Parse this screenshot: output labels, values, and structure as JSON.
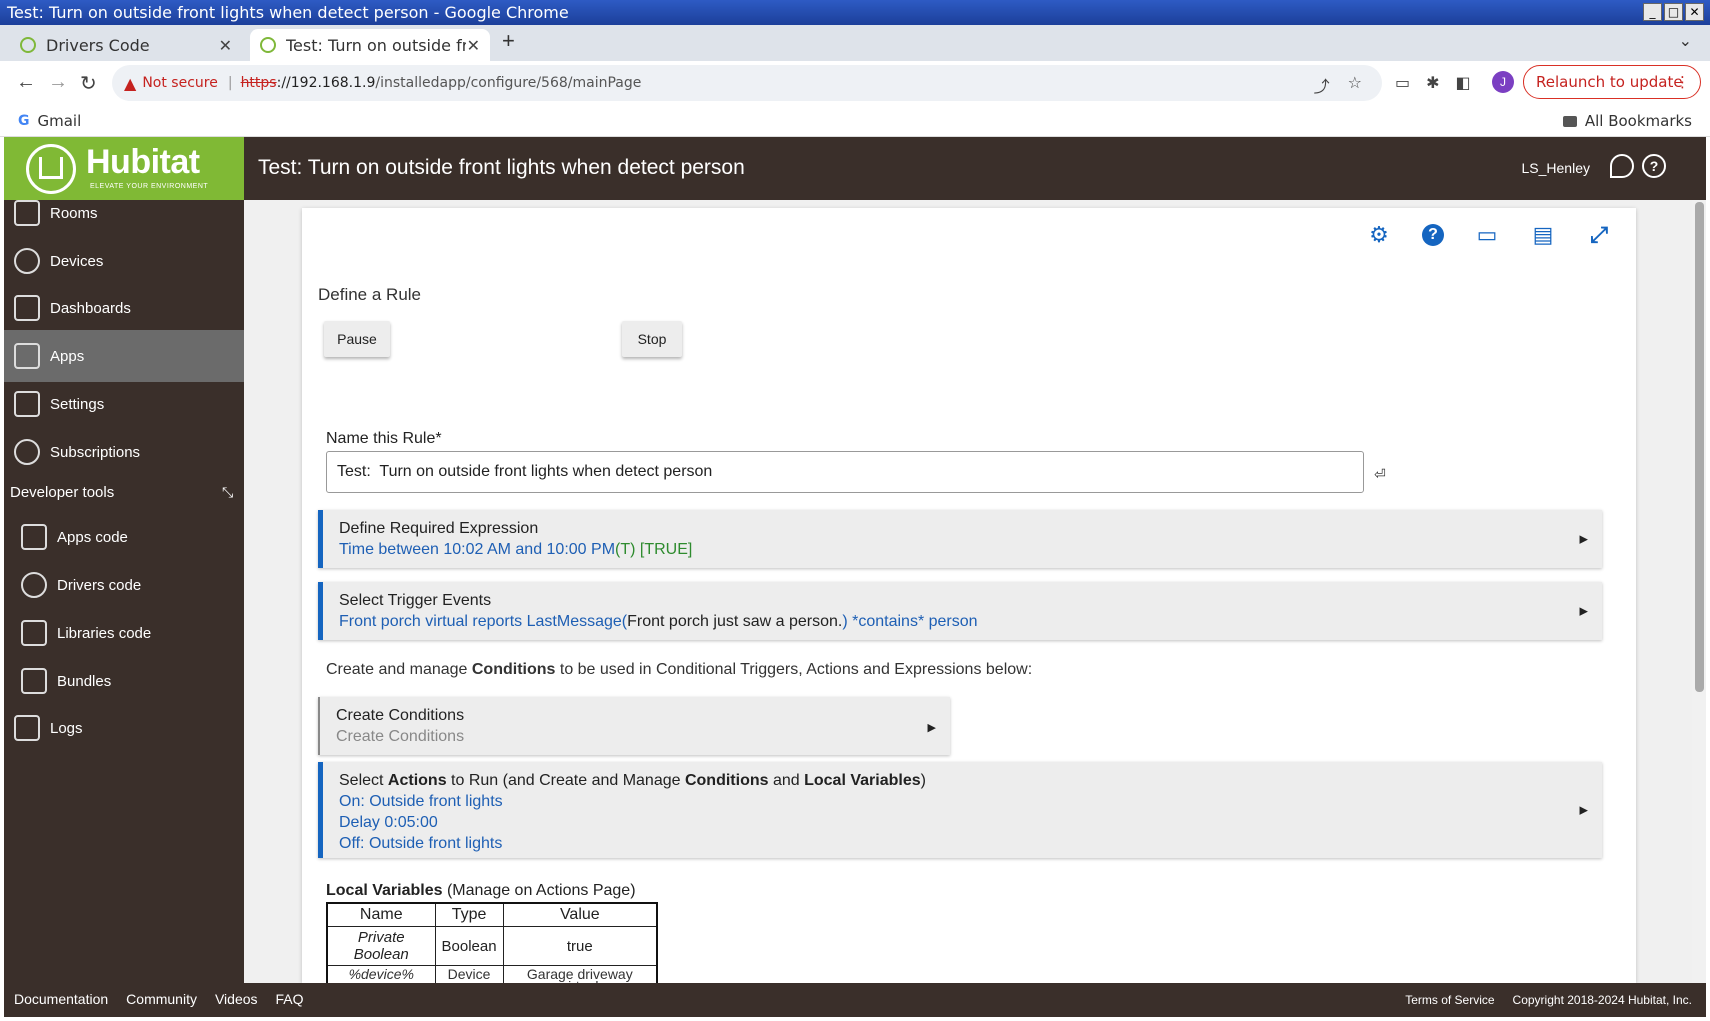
{
  "window": {
    "title": "Test: Turn on outside front lights when detect person - Google Chrome"
  },
  "tabs": [
    {
      "label": "Drivers Code"
    },
    {
      "label": "Test: Turn on outside fro"
    }
  ],
  "address": {
    "security": "Not secure",
    "scheme": "https",
    "host": "://192.168.1.9",
    "path": "/installedapp/configure/568/mainPage",
    "relaunch": "Relaunch to update",
    "profile_initial": "J"
  },
  "bookmarks": {
    "gmail": "Gmail",
    "all": "All Bookmarks"
  },
  "header": {
    "logo_text": "Hubitat",
    "logo_tagline": "ELEVATE YOUR ENVIRONMENT",
    "title": "Test: Turn on outside front lights when detect person",
    "user": "LS_Henley"
  },
  "sidebar": {
    "items": [
      {
        "label": "Rooms"
      },
      {
        "label": "Devices"
      },
      {
        "label": "Dashboards"
      },
      {
        "label": "Apps"
      },
      {
        "label": "Settings"
      },
      {
        "label": "Subscriptions"
      }
    ],
    "dev_tools_label": "Developer tools",
    "dev_items": [
      {
        "label": "Apps code"
      },
      {
        "label": "Drivers code"
      },
      {
        "label": "Libraries code"
      },
      {
        "label": "Bundles"
      },
      {
        "label": "Logs"
      }
    ]
  },
  "main": {
    "define_title": "Define a Rule",
    "pause_label": "Pause",
    "stop_label": "Stop",
    "name_label": "Name this Rule*",
    "name_value": "Test:  Turn on outside front lights when detect person",
    "required_expr": {
      "title": "Define Required Expression",
      "text": "Time between 10:02 AM and 10:00 PM",
      "state1": "(T)",
      "state2": " [TRUE]"
    },
    "trigger": {
      "title": "Select Trigger Events",
      "part1": "Front porch virtual reports LastMessage(",
      "part2": "Front porch just saw a person.",
      "part3": ") *contains* person"
    },
    "conditions_intro": {
      "pre": "Create and manage ",
      "bold": "Conditions",
      "post": " to be used in Conditional Triggers, Actions and Expressions below:"
    },
    "create_conditions": {
      "title": "Create Conditions",
      "sub": "Create Conditions"
    },
    "actions": {
      "t1": "Select ",
      "b1": "Actions",
      "t2": " to Run (and Create and Manage ",
      "b2": "Conditions",
      "t3": " and ",
      "b3": "Local Variables",
      "t4": ")",
      "lines": [
        "On: Outside front lights",
        "Delay 0:05:00",
        "Off: Outside front lights"
      ]
    },
    "local_vars": {
      "bold": "Local Variables",
      "rest": " (Manage on Actions Page)",
      "headers": [
        "Name",
        "Type",
        "Value"
      ],
      "rows": [
        [
          "Private Boolean",
          "Boolean",
          "true"
        ],
        [
          "%device%",
          "Device",
          "Garage driveway virtual"
        ]
      ]
    }
  },
  "footer": {
    "links": [
      "Documentation",
      "Community",
      "Videos",
      "FAQ"
    ],
    "terms": "Terms of Service",
    "copyright": "Copyright 2018-2024 Hubitat, Inc."
  }
}
